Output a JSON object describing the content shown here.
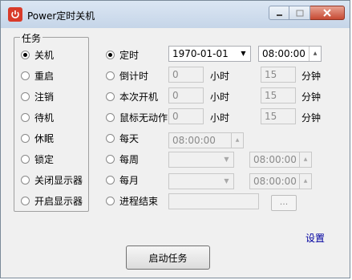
{
  "window": {
    "title": "Power定时关机"
  },
  "tasks": {
    "group_title": "任务",
    "items": [
      {
        "label": "关机",
        "checked": true
      },
      {
        "label": "重启",
        "checked": false
      },
      {
        "label": "注销",
        "checked": false
      },
      {
        "label": "待机",
        "checked": false
      },
      {
        "label": "休眠",
        "checked": false
      },
      {
        "label": "锁定",
        "checked": false
      },
      {
        "label": "关闭显示器",
        "checked": false
      },
      {
        "label": "开启显示器",
        "checked": false
      }
    ]
  },
  "modes": {
    "scheduled": {
      "label": "定时",
      "checked": true,
      "date_value": "1970-01-01",
      "time_value": "08:00:00"
    },
    "countdown": {
      "label": "倒计时",
      "hours_value": "0",
      "hours_unit": "小时",
      "minutes_value": "15",
      "minutes_unit": "分钟"
    },
    "boot": {
      "label": "本次开机",
      "hours_value": "0",
      "hours_unit": "小时",
      "minutes_value": "15",
      "minutes_unit": "分钟"
    },
    "idle": {
      "label": "鼠标无动作",
      "hours_value": "0",
      "hours_unit": "小时",
      "minutes_value": "15",
      "minutes_unit": "分钟"
    },
    "daily": {
      "label": "每天",
      "time_value": "08:00:00"
    },
    "weekly": {
      "label": "每周",
      "day_value": "",
      "time_value": "08:00:00"
    },
    "monthly": {
      "label": "每月",
      "day_value": "",
      "time_value": "08:00:00"
    },
    "process": {
      "label": "进程结束",
      "process_value": "",
      "browse_label": "..."
    }
  },
  "settings_link": "设置",
  "start_button": "启动任务"
}
